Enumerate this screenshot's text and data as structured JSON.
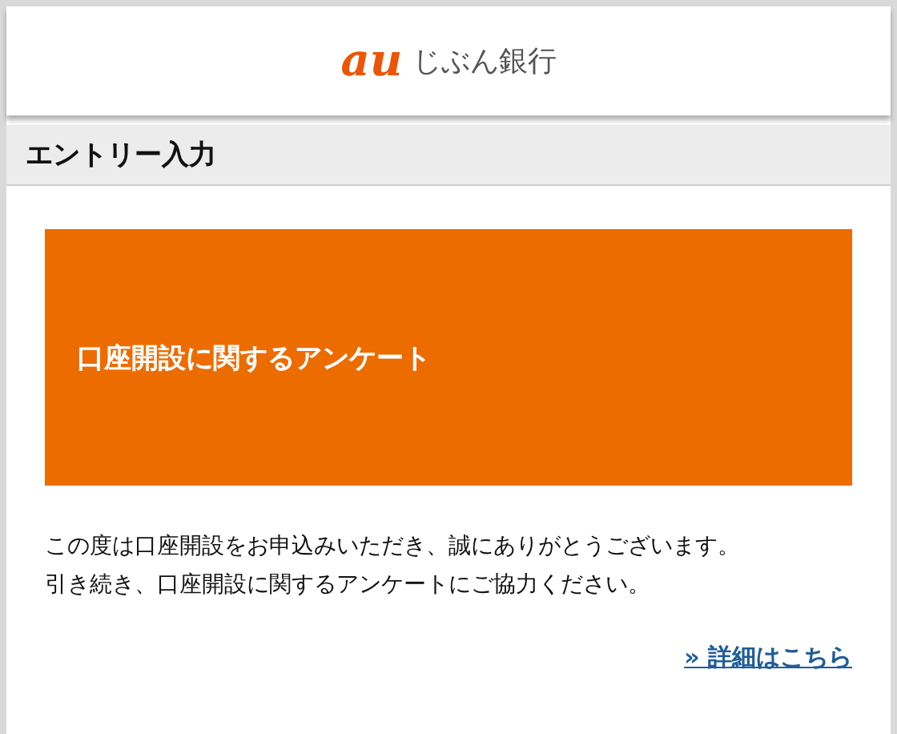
{
  "header": {
    "logo_mark": "au",
    "logo_text": "じぶん銀行"
  },
  "section_title": "エントリー入力",
  "banner": {
    "title": "口座開設に関するアンケート"
  },
  "message": [
    "この度は口座開設をお申込みいただき、誠にありがとうございます。",
    "引き続き、口座開設に関するアンケートにご協力ください。"
  ],
  "link": "» 詳細はこちら"
}
